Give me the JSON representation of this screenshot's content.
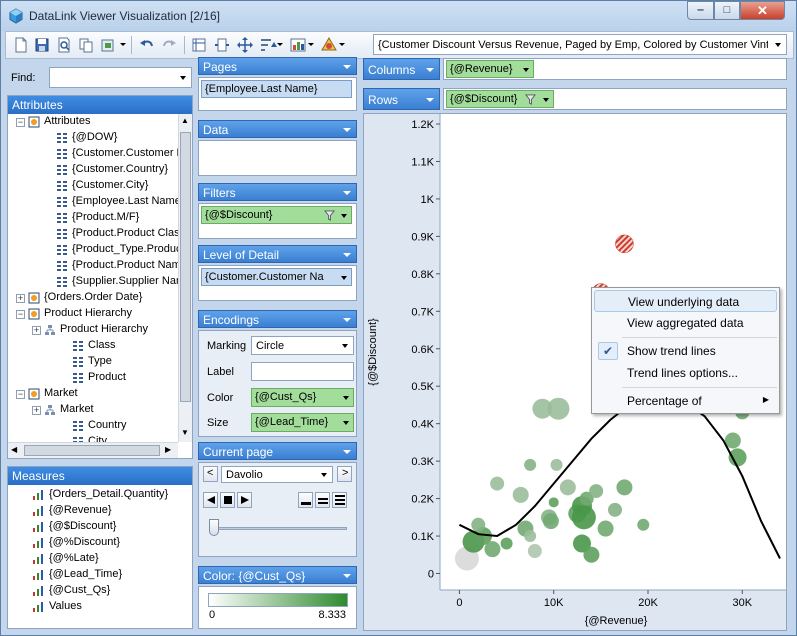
{
  "window": {
    "title": "DataLink Viewer Visualization [2/16]",
    "minimize_glyph": "‒",
    "maximize_glyph": "□",
    "close_glyph": "✕"
  },
  "toolbar": {
    "view_selector_value": "{Customer Discount Versus Revenue, Paged by Emp, Colored by Customer Vintage"
  },
  "find": {
    "label": "Find:",
    "value": ""
  },
  "attributes": {
    "header": "Attributes",
    "items": [
      {
        "label": "Attributes",
        "level": 0,
        "expander": "−",
        "icon": "hierarchy-folder-icon"
      },
      {
        "label": "{@DOW}",
        "level": 1,
        "icon": "dimension-icon"
      },
      {
        "label": "{Customer.Customer Na",
        "level": 1,
        "icon": "dimension-icon"
      },
      {
        "label": "{Customer.Country}",
        "level": 1,
        "icon": "dimension-icon"
      },
      {
        "label": "{Customer.City}",
        "level": 1,
        "icon": "dimension-icon"
      },
      {
        "label": "{Employee.Last Name}",
        "level": 1,
        "icon": "dimension-icon"
      },
      {
        "label": "{Product.M/F}",
        "level": 1,
        "icon": "dimension-icon"
      },
      {
        "label": "{Product.Product Class}",
        "level": 1,
        "icon": "dimension-icon"
      },
      {
        "label": "{Product_Type.Product",
        "level": 1,
        "icon": "dimension-icon"
      },
      {
        "label": "{Product.Product Name",
        "level": 1,
        "icon": "dimension-icon"
      },
      {
        "label": "{Supplier.Supplier Nam",
        "level": 1,
        "icon": "dimension-icon"
      },
      {
        "label": "{Orders.Order Date}",
        "level": 0,
        "expander": "+",
        "icon": "hierarchy-folder-icon"
      },
      {
        "label": "Product Hierarchy",
        "level": 0,
        "expander": "−",
        "icon": "hierarchy-folder-icon"
      },
      {
        "label": "Product Hierarchy",
        "level": 1,
        "expander": "+",
        "icon": "hierarchy-icon"
      },
      {
        "label": "Class",
        "level": 2,
        "icon": "dimension-icon"
      },
      {
        "label": "Type",
        "level": 2,
        "icon": "dimension-icon"
      },
      {
        "label": "Product",
        "level": 2,
        "icon": "dimension-icon"
      },
      {
        "label": "Market",
        "level": 0,
        "expander": "−",
        "icon": "hierarchy-folder-icon"
      },
      {
        "label": "Market",
        "level": 1,
        "expander": "+",
        "icon": "hierarchy-icon"
      },
      {
        "label": "Country",
        "level": 2,
        "icon": "dimension-icon"
      },
      {
        "label": "City",
        "level": 2,
        "icon": "dimension-icon"
      }
    ]
  },
  "measures": {
    "header": "Measures",
    "items": [
      "{Orders_Detail.Quantity}",
      "{@Revenue}",
      "{@$Discount}",
      "{@%Discount}",
      "{@%Late}",
      "{@Lead_Time}",
      "{@Cust_Qs}",
      "Values"
    ]
  },
  "shelves": {
    "pages": {
      "header": "Pages",
      "pill": "{Employee.Last Name}"
    },
    "data": {
      "header": "Data"
    },
    "filters": {
      "header": "Filters",
      "pill": "{@$Discount}"
    },
    "level_of_detail": {
      "header": "Level of Detail",
      "pill": "{Customer.Customer  Na"
    },
    "encodings": {
      "header": "Encodings",
      "marking_label": "Marking",
      "marking_value": "Circle",
      "label_label": "Label",
      "label_value": "",
      "color_label": "Color",
      "color_value": "{@Cust_Qs}",
      "size_label": "Size",
      "size_value": "{@Lead_Time}"
    },
    "current_page": {
      "header": "Current page",
      "value": "Davolio",
      "prev": "<",
      "next": ">"
    },
    "color_legend": {
      "header": "Color: {@Cust_Qs}",
      "min": "0",
      "max": "8.333",
      "color_from": "#ffffff",
      "color_to": "#2e8b2e"
    }
  },
  "columns": {
    "label": "Columns",
    "pill": "{@Revenue}"
  },
  "rows": {
    "label": "Rows",
    "pill": "{@$Discount}"
  },
  "chart_data": {
    "type": "scatter",
    "xlabel": "{@Revenue}",
    "ylabel": "{@$Discount}",
    "xlim": [
      -1000,
      34000
    ],
    "ylim": [
      -20,
      1200
    ],
    "x_ticks": [
      {
        "value": 0,
        "label": "0"
      },
      {
        "value": 10000,
        "label": "10K"
      },
      {
        "value": 20000,
        "label": "20K"
      },
      {
        "value": 30000,
        "label": "30K"
      }
    ],
    "y_ticks": [
      {
        "value": 0,
        "label": "0"
      },
      {
        "value": 100,
        "label": "0.1K"
      },
      {
        "value": 200,
        "label": "0.2K"
      },
      {
        "value": 300,
        "label": "0.3K"
      },
      {
        "value": 400,
        "label": "0.4K"
      },
      {
        "value": 500,
        "label": "0.5K"
      },
      {
        "value": 600,
        "label": "0.6K"
      },
      {
        "value": 700,
        "label": "0.7K"
      },
      {
        "value": 800,
        "label": "0.8K"
      },
      {
        "value": 900,
        "label": "0.9K"
      },
      {
        "value": 1000,
        "label": "1K"
      },
      {
        "value": 1100,
        "label": "1.1K"
      },
      {
        "value": 1200,
        "label": "1.2K"
      }
    ],
    "points": [
      {
        "x": 800,
        "y": 40,
        "r": 12,
        "c": 0
      },
      {
        "x": 1500,
        "y": 85,
        "r": 11,
        "c": 7
      },
      {
        "x": 2500,
        "y": 100,
        "r": 9,
        "c": 6
      },
      {
        "x": 2000,
        "y": 130,
        "r": 7,
        "c": 4
      },
      {
        "x": 3500,
        "y": 65,
        "r": 8,
        "c": 5
      },
      {
        "x": 4000,
        "y": 240,
        "r": 7,
        "c": 3
      },
      {
        "x": 5000,
        "y": 80,
        "r": 6,
        "c": 6
      },
      {
        "x": 6500,
        "y": 210,
        "r": 8,
        "c": 3
      },
      {
        "x": 7000,
        "y": 120,
        "r": 8,
        "c": 5
      },
      {
        "x": 7500,
        "y": 290,
        "r": 6,
        "c": 4
      },
      {
        "x": 8000,
        "y": 60,
        "r": 7,
        "c": 2
      },
      {
        "x": 7500,
        "y": 100,
        "r": 6,
        "c": 3
      },
      {
        "x": 8800,
        "y": 440,
        "r": 10,
        "c": 3
      },
      {
        "x": 9500,
        "y": 150,
        "r": 8,
        "c": 4
      },
      {
        "x": 9700,
        "y": 140,
        "r": 8,
        "c": 5
      },
      {
        "x": 10300,
        "y": 290,
        "r": 6,
        "c": 3
      },
      {
        "x": 10000,
        "y": 190,
        "r": 5,
        "c": 6
      },
      {
        "x": 10500,
        "y": 440,
        "r": 11,
        "c": 3
      },
      {
        "x": 11500,
        "y": 230,
        "r": 8,
        "c": 3
      },
      {
        "x": 12500,
        "y": 160,
        "r": 9,
        "c": 6
      },
      {
        "x": 13000,
        "y": 180,
        "r": 10,
        "c": 7
      },
      {
        "x": 13500,
        "y": 200,
        "r": 7,
        "c": 5
      },
      {
        "x": 13000,
        "y": 80,
        "r": 9,
        "c": 7
      },
      {
        "x": 13200,
        "y": 150,
        "r": 12,
        "c": 7
      },
      {
        "x": 14000,
        "y": 50,
        "r": 8,
        "c": 6
      },
      {
        "x": 14500,
        "y": 220,
        "r": 7,
        "c": 4
      },
      {
        "x": 15500,
        "y": 120,
        "r": 8,
        "c": 5
      },
      {
        "x": 16500,
        "y": 170,
        "r": 7,
        "c": 4
      },
      {
        "x": 17500,
        "y": 230,
        "r": 8,
        "c": 5
      },
      {
        "x": 15000,
        "y": 750,
        "r": 9,
        "c": 9,
        "hatched": true
      },
      {
        "x": 17500,
        "y": 880,
        "r": 9,
        "c": 9,
        "hatched": true
      },
      {
        "x": 19500,
        "y": 130,
        "r": 6,
        "c": 5
      },
      {
        "x": 22000,
        "y": 480,
        "r": 7,
        "c": 3
      },
      {
        "x": 29000,
        "y": 355,
        "r": 8,
        "c": 5
      },
      {
        "x": 29500,
        "y": 310,
        "r": 9,
        "c": 6
      },
      {
        "x": 30000,
        "y": 430,
        "r": 7,
        "c": 5
      }
    ],
    "trend_line": [
      {
        "x": 0,
        "y": 130
      },
      {
        "x": 2000,
        "y": 105
      },
      {
        "x": 4000,
        "y": 100
      },
      {
        "x": 6000,
        "y": 130
      },
      {
        "x": 8000,
        "y": 180
      },
      {
        "x": 10000,
        "y": 240
      },
      {
        "x": 12000,
        "y": 300
      },
      {
        "x": 14000,
        "y": 360
      },
      {
        "x": 16000,
        "y": 410
      },
      {
        "x": 18000,
        "y": 450
      },
      {
        "x": 20000,
        "y": 470
      },
      {
        "x": 22000,
        "y": 470
      },
      {
        "x": 24000,
        "y": 455
      },
      {
        "x": 26000,
        "y": 420
      },
      {
        "x": 28000,
        "y": 355
      },
      {
        "x": 30000,
        "y": 260
      },
      {
        "x": 32000,
        "y": 140
      },
      {
        "x": 34000,
        "y": 40
      }
    ]
  },
  "context_menu": {
    "items": [
      {
        "label": "View underlying data",
        "highlighted": true
      },
      {
        "label": "View aggregated data"
      },
      {
        "separator": true
      },
      {
        "label": "Show trend lines",
        "checked": true
      },
      {
        "label": "Trend lines options..."
      },
      {
        "separator": true
      },
      {
        "label": "Percentage of",
        "submenu": true
      }
    ],
    "check_glyph": "✔",
    "submenu_glyph": "▶"
  }
}
